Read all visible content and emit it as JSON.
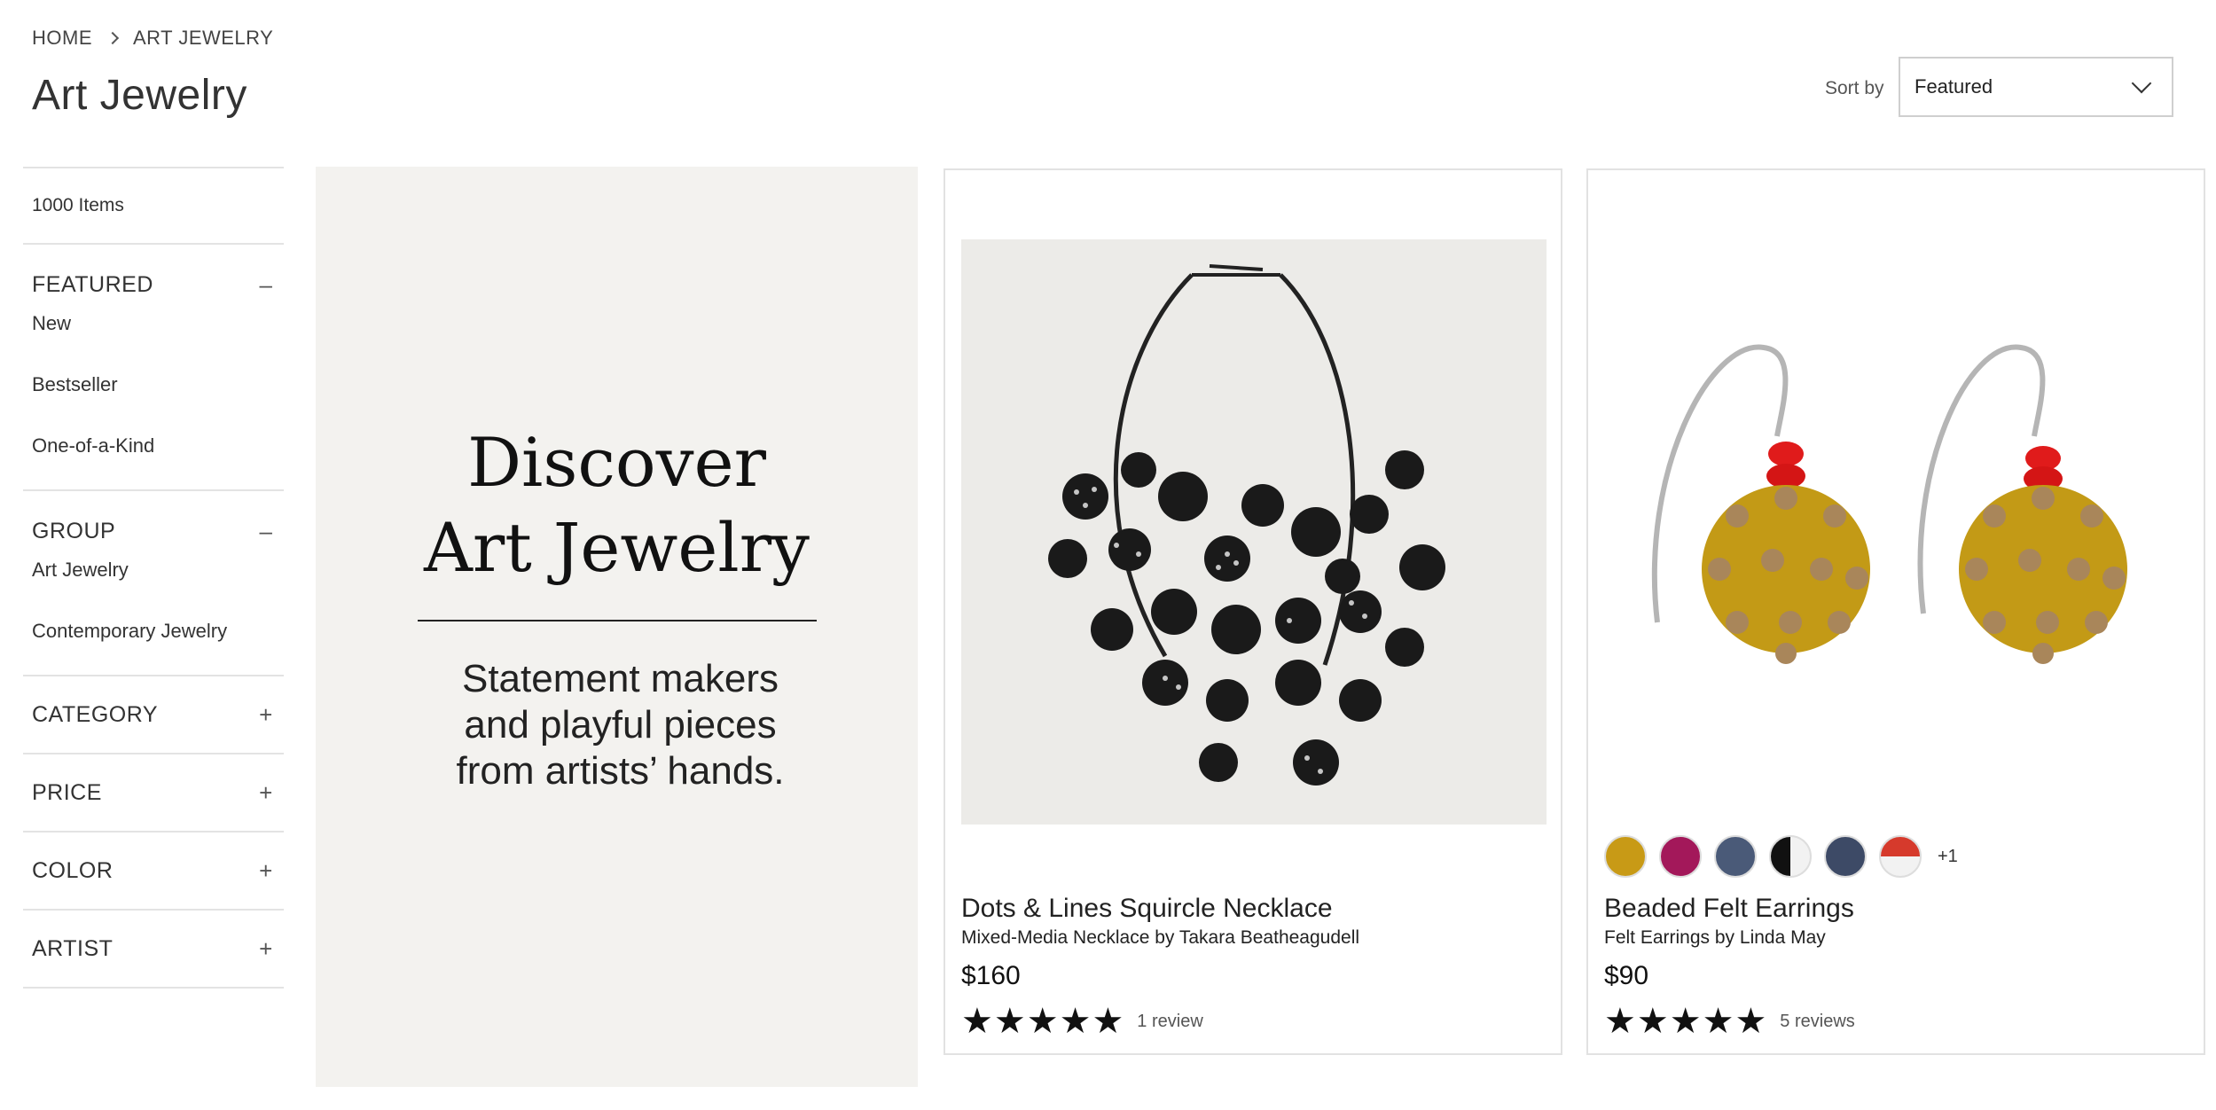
{
  "breadcrumb": {
    "home": "HOME",
    "current": "ART JEWELRY"
  },
  "page": {
    "title": "Art Jewelry"
  },
  "sort": {
    "label": "Sort by",
    "value": "Featured"
  },
  "sidebar": {
    "count": "1000 Items",
    "sections": {
      "featured": {
        "label": "FEATURED",
        "toggle": "–",
        "items": [
          "New",
          "Bestseller",
          "One-of-a-Kind"
        ]
      },
      "group": {
        "label": "GROUP",
        "toggle": "–",
        "items": [
          "Art Jewelry",
          "Contemporary Jewelry"
        ]
      },
      "category": {
        "label": "CATEGORY",
        "toggle": "+"
      },
      "price": {
        "label": "PRICE",
        "toggle": "+"
      },
      "color": {
        "label": "COLOR",
        "toggle": "+"
      },
      "artist": {
        "label": "ARTIST",
        "toggle": "+"
      }
    }
  },
  "promo": {
    "title_line1": "Discover",
    "title_line2": "Art Jewelry",
    "sub_line1": "Statement makers",
    "sub_line2": "and playful pieces",
    "sub_line3": "from artists’ hands."
  },
  "products": [
    {
      "title": "Dots & Lines Squircle Necklace",
      "subtitle": "Mixed-Media Necklace by Takara Beatheagudell",
      "price": "$160",
      "stars": "★★★★★",
      "rating": 5,
      "reviews": "1 review"
    },
    {
      "title": "Beaded Felt Earrings",
      "subtitle": "Felt Earrings by Linda May",
      "price": "$90",
      "stars": "★★★★★",
      "rating": 5,
      "reviews": "5 reviews",
      "swatches": [
        "#c89a16",
        "#a3185a",
        "#4a5a78",
        "#f2f2f2",
        "#3d4a66",
        "#d63a2c"
      ],
      "swatch_more": "+1"
    }
  ]
}
